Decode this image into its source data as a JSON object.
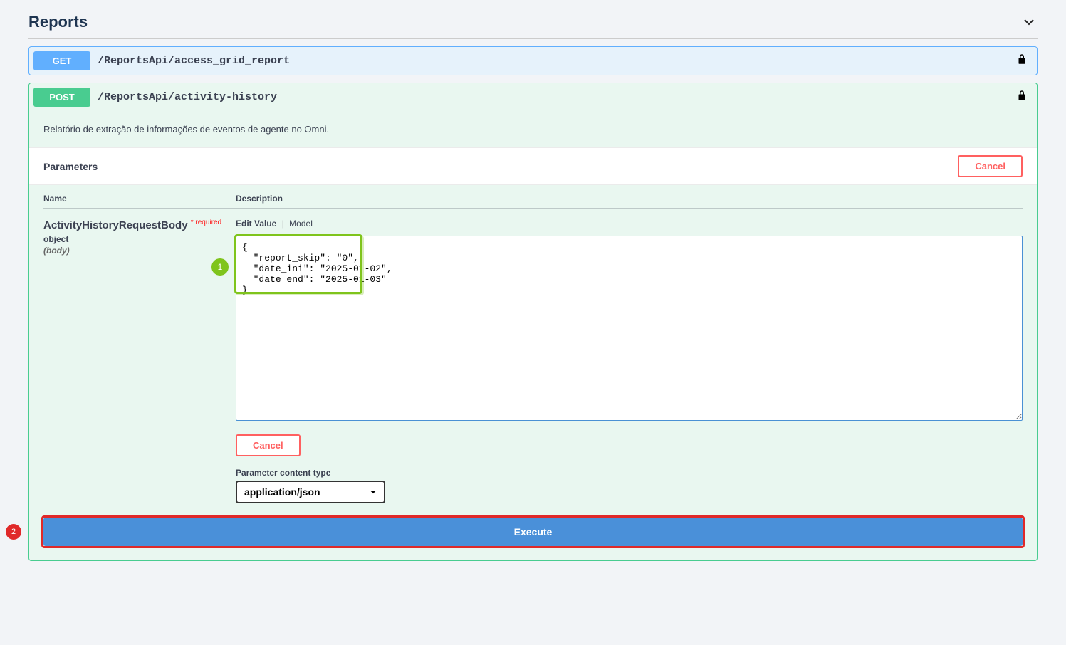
{
  "section_title": "Reports",
  "operations": {
    "get": {
      "method": "GET",
      "path": "/ReportsApi/access_grid_report"
    },
    "post": {
      "method": "POST",
      "path": "/ReportsApi/activity-history",
      "description": "Relatório de extração de informações de eventos de agente no Omni.",
      "parameters_title": "Parameters",
      "cancel_label": "Cancel",
      "table_headers": {
        "name": "Name",
        "description": "Description"
      },
      "param": {
        "name": "ActivityHistoryRequestBody",
        "required_marker": "*",
        "required_label": "required",
        "type": "object",
        "in": "(body)"
      },
      "model_toggle": {
        "edit": "Edit Value",
        "model": "Model"
      },
      "body_value": "{\n  \"report_skip\": \"0\",\n  \"date_ini\": \"2025-01-02\",\n  \"date_end\": \"2025-01-03\"\n}",
      "cancel_small_label": "Cancel",
      "content_type_label": "Parameter content type",
      "content_type_value": "application/json",
      "execute_label": "Execute"
    }
  },
  "annotations": {
    "marker1": "1",
    "marker2": "2"
  }
}
